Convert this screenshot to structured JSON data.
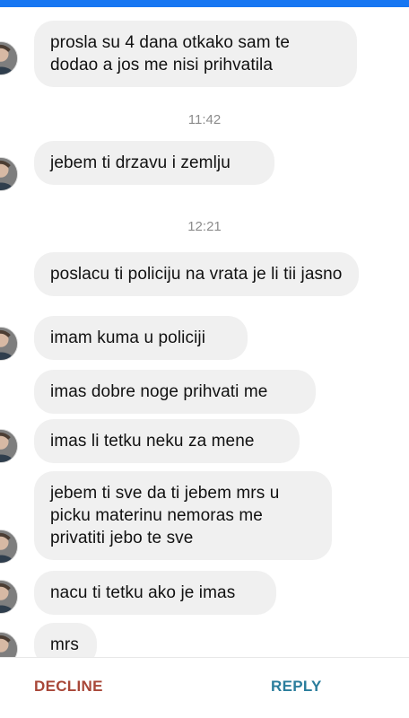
{
  "colors": {
    "top_strip": "#1877f2",
    "bubble_bg": "#f0f0f0",
    "text": "#111111",
    "timestamp": "#8c8c8c",
    "decline": "#a84738",
    "reply": "#2a7d9c"
  },
  "messages": [
    {
      "text": "prosla su 4 dana otkako sam te dodao a jos me nisi prihvatila",
      "has_avatar": true
    },
    {
      "text": "jebem ti drzavu i zemlju",
      "has_avatar": true
    },
    {
      "text": "poslacu ti policiju na vrata je li tii jasno",
      "has_avatar": false
    },
    {
      "text": "imam kuma u policiji",
      "has_avatar": true
    },
    {
      "text": "imas dobre noge prihvati me",
      "has_avatar": false
    },
    {
      "text": "imas li tetku neku za mene",
      "has_avatar": true
    },
    {
      "text": "jebem ti sve da ti jebem mrs  u picku materinu nemoras me privatiti jebo te sve",
      "has_avatar": true
    },
    {
      "text": "nacu ti tetku ako je imas",
      "has_avatar": true
    },
    {
      "text": "mrs",
      "has_avatar": true
    }
  ],
  "timestamps": [
    "11:42",
    "12:21"
  ],
  "actions": {
    "decline": "DECLINE",
    "reply": "REPLY"
  },
  "icons": {
    "avatar": "profile-avatar-icon"
  }
}
